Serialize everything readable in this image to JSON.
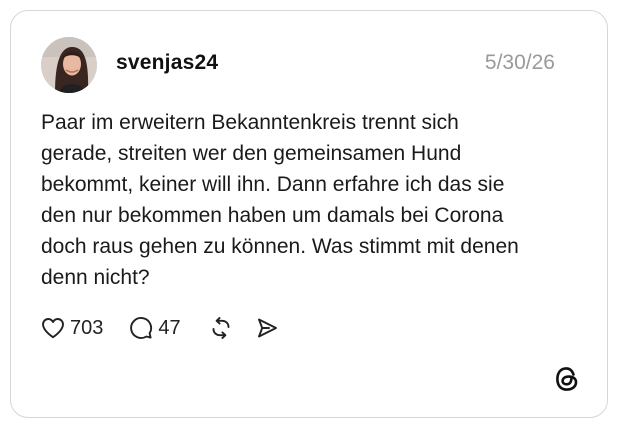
{
  "post": {
    "username": "svenjas24",
    "date": "5/30/26",
    "text_lines": [
      "Paar im erweitern Bekanntenkreis trennt sich",
      "gerade, streiten wer den gemeinsamen Hund",
      "bekommt, keiner will ihn. Dann erfahre ich das sie",
      "den nur bekommen haben um damals bei Corona",
      "doch raus gehen zu können. Was stimmt mit denen",
      "denn nicht?"
    ],
    "likes": "703",
    "replies": "47"
  },
  "icons": {
    "like": "heart-icon",
    "reply": "speech-bubble-icon",
    "repost": "repost-icon",
    "share": "send-icon",
    "brand": "threads-logo-icon"
  },
  "colors": {
    "text": "#1a1a1a",
    "muted": "#9a9a9a",
    "border": "#d6d6d6"
  }
}
